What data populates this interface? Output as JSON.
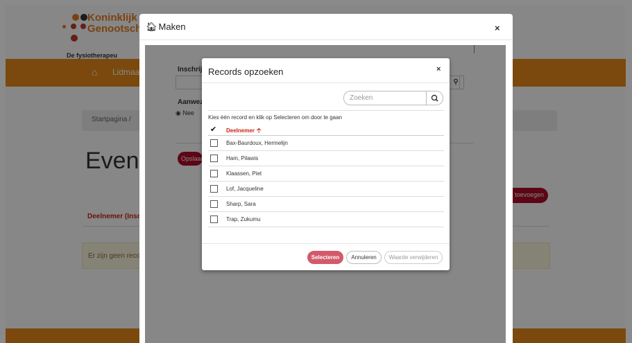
{
  "background": {
    "logo_line1": "Koninklijk N",
    "logo_line2": "Genootscha",
    "logo_tagline": "De fysiotherapeu",
    "nav_item": "Lidmaat",
    "breadcrumb": "Startpagina /",
    "page_title": "Evene",
    "add_button": "toevoegen",
    "column_header": "Deelnemer (Insch",
    "empty_alert": "Er zijn geen recor",
    "colors": {
      "brand_orange": "#e88a1a",
      "accent_red": "#b00c28"
    }
  },
  "outer_modal": {
    "title": "Maken",
    "title_icon": "house-icon",
    "close": "×",
    "inschrijving_label": "Inschrijv",
    "aanwezig_label": "Aanwezi",
    "radio_nee": "Nee",
    "save_button": "Opslaan"
  },
  "lookup_modal": {
    "title": "Records opzoeken",
    "close": "×",
    "search_placeholder": "Zoeken",
    "instruction": "Kies één record en klik op Selecteren om door te gaan",
    "column_header": "Deelnemer",
    "sort_icon": "sort-up-icon",
    "records": [
      "Bax-Baurdoux, Hermelijn",
      "Ham, Pilawis",
      "Klaassen, Piet",
      "Lof, Jacqueline",
      "Sharp, Sara",
      "Trap, Zukumu"
    ],
    "buttons": {
      "select": "Selecteren",
      "cancel": "Annuleren",
      "clear": "Waarde verwijderen"
    }
  }
}
